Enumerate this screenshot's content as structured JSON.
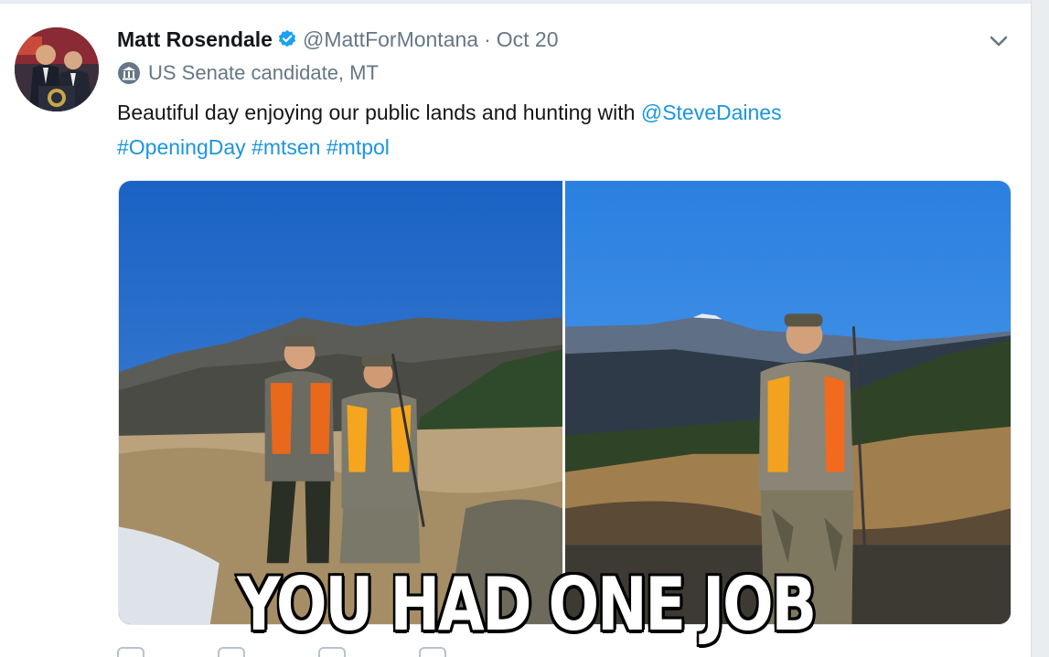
{
  "tweet": {
    "author_name": "Matt Rosendale",
    "handle": "@MattForMontana",
    "separator": "·",
    "date": "Oct 20",
    "label": "US Senate candidate, MT",
    "text_before": "Beautiful day enjoying our public lands and hunting with ",
    "mention": "@SteveDaines",
    "hashtags": [
      "#OpeningDay",
      "#mtsen",
      "#mtpol"
    ]
  },
  "icons": {
    "verified": "verified-badge-icon",
    "caret": "chevron-down-icon",
    "government": "government-building-icon"
  },
  "meme_caption": "YOU HAD ONE JOB",
  "colors": {
    "link": "#1b95e0",
    "secondary_text": "#657786",
    "verified": "#1da1f2",
    "sky": "#1e6fd0"
  }
}
